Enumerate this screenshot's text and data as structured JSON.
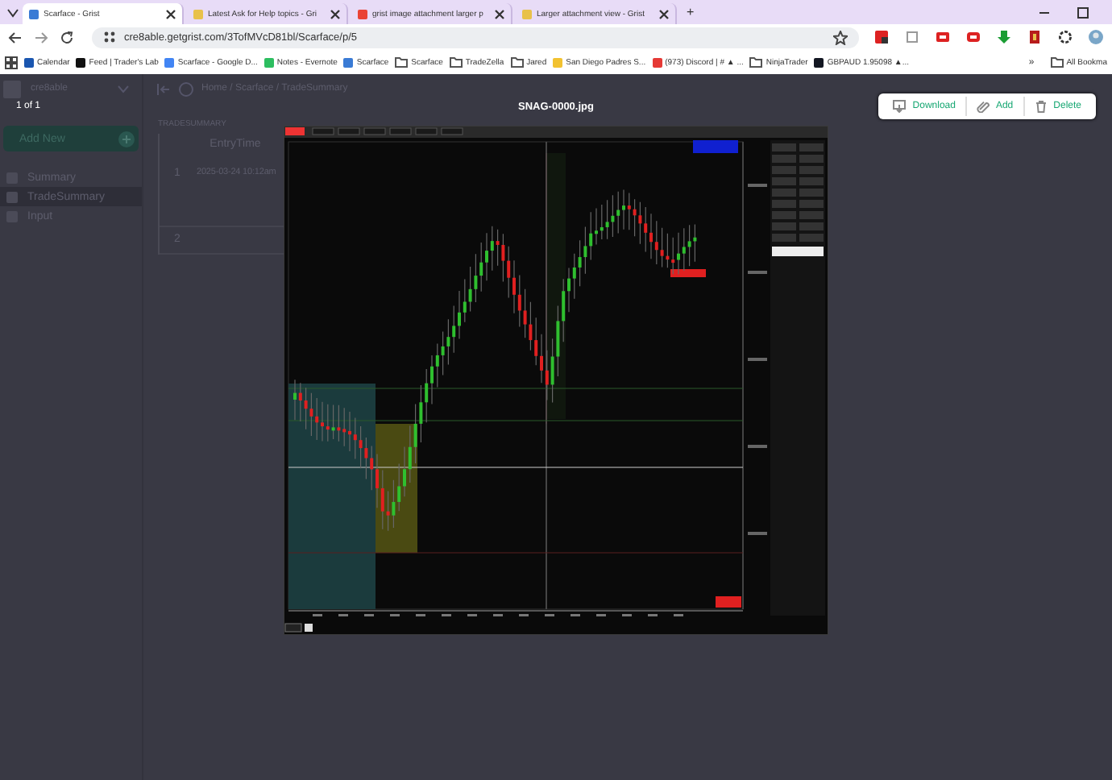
{
  "browser": {
    "tabs": [
      {
        "title": "Scarface - Grist",
        "selected": true,
        "color": "#3a7bd5"
      },
      {
        "title": "Latest Ask for Help topics - Gri",
        "selected": false,
        "color": "#e8c14a"
      },
      {
        "title": "grist image attachment larger p",
        "selected": false,
        "color": "#ea4335"
      },
      {
        "title": "Larger attachment view - Grist",
        "selected": false,
        "color": "#e8c14a"
      }
    ],
    "new_tab": "+",
    "address": "cre8able.getgrist.com/3TofMVcD81bl/Scarface/p/5",
    "bookmarks": [
      {
        "label": "Calendar",
        "kind": "site",
        "color": "#1a56b0"
      },
      {
        "label": "Feed | Trader's Lab",
        "kind": "site",
        "color": "#111111"
      },
      {
        "label": "Scarface - Google D...",
        "kind": "site",
        "color": "#4285f4"
      },
      {
        "label": "Notes - Evernote",
        "kind": "site",
        "color": "#2dbe60"
      },
      {
        "label": "Scarface",
        "kind": "site",
        "color": "#3a7bd5"
      },
      {
        "label": "Scarface",
        "kind": "folder"
      },
      {
        "label": "TradeZella",
        "kind": "folder"
      },
      {
        "label": "Jared",
        "kind": "folder"
      },
      {
        "label": "San Diego Padres S...",
        "kind": "site",
        "color": "#f2c230"
      },
      {
        "label": "(973) Discord | # ▲ ...",
        "kind": "site",
        "color": "#e53935"
      },
      {
        "label": "NinjaTrader",
        "kind": "folder"
      },
      {
        "label": "GBPAUD 1.95098 ▲...",
        "kind": "site",
        "color": "#131722"
      }
    ],
    "more_bookmarks": "»",
    "all_bookmarks": "All Bookma"
  },
  "grist": {
    "workspace": "cre8able",
    "add_new": "Add New",
    "pages": [
      {
        "label": "Summary",
        "selected": false
      },
      {
        "label": "TradeSummary",
        "selected": true
      },
      {
        "label": "Input",
        "selected": false
      }
    ],
    "breadcrumb": "Home / Scarface / TradeSummary",
    "section_title": "TRADESUMMARY",
    "column": "EntryTime",
    "rows": [
      {
        "number": "1",
        "entry_time": "2025-03-24 10:12am"
      },
      {
        "number": "2"
      }
    ]
  },
  "viewer": {
    "counter": "1 of 1",
    "filename": "SNAG-0000.jpg",
    "actions": [
      {
        "label": "Download",
        "kind": "download"
      },
      {
        "label": "Add",
        "kind": "add"
      },
      {
        "label": "Delete",
        "kind": "delete"
      }
    ]
  }
}
